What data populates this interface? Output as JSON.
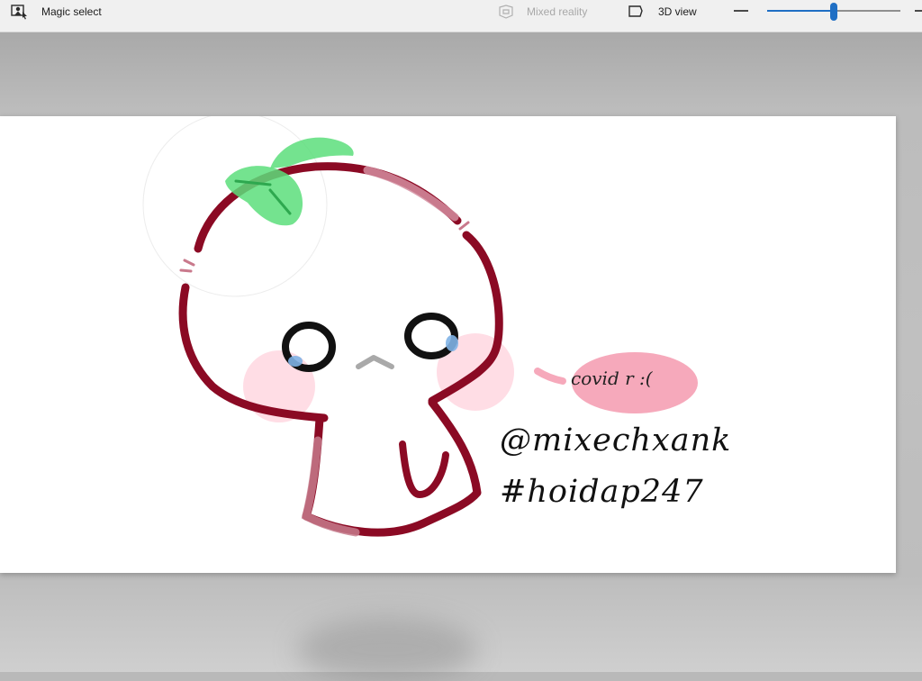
{
  "toolbar": {
    "magic_select": {
      "label": "Magic select",
      "icon": "magic-select-icon"
    },
    "mixed_reality": {
      "label": "Mixed reality",
      "icon": "mixed-reality-icon",
      "enabled": false
    },
    "view_3d": {
      "label": "3D view",
      "icon": "3d-view-icon"
    },
    "zoom": {
      "level_fraction": 0.5
    }
  },
  "artwork": {
    "speech_text": "covid r :(",
    "handle": "@mixechxank",
    "hashtag": "#hoidap247"
  },
  "colors": {
    "outline": "#8b0a24",
    "leaf": "#5cde7b",
    "blush": "#ffc7d4",
    "speech_bubble": "#f6a9bb",
    "accent": "#1f6fc4"
  }
}
